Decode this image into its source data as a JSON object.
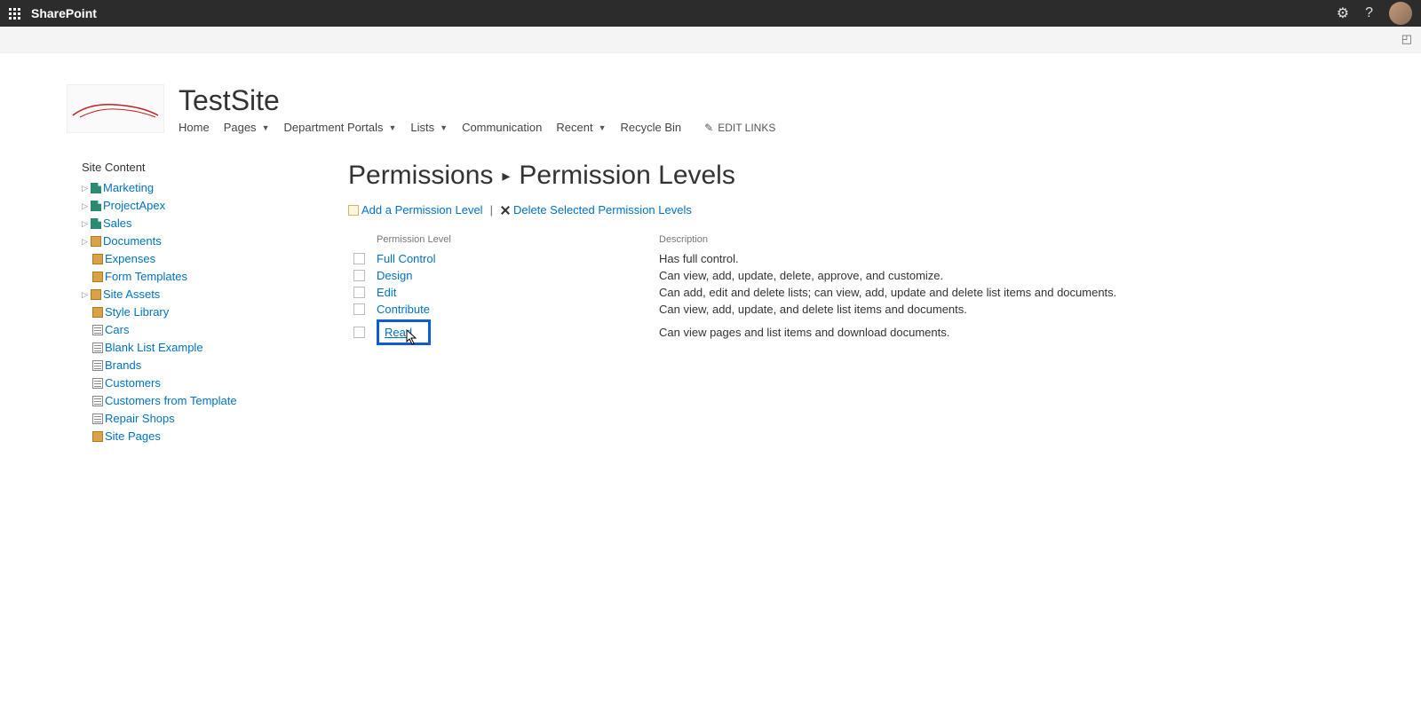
{
  "topbar": {
    "app_name": "SharePoint"
  },
  "site": {
    "title": "TestSite"
  },
  "nav": {
    "home": "Home",
    "pages": "Pages",
    "dept": "Department Portals",
    "lists": "Lists",
    "comm": "Communication",
    "recent": "Recent",
    "recycle": "Recycle Bin",
    "edit_links": "EDIT LINKS"
  },
  "left": {
    "heading": "Site Content",
    "items": {
      "marketing": "Marketing",
      "projectapex": "ProjectApex",
      "sales": "Sales",
      "documents": "Documents",
      "expenses": "Expenses",
      "formtemplates": "Form Templates",
      "siteassets": "Site Assets",
      "stylelibrary": "Style Library",
      "cars": "Cars",
      "blanklist": "Blank List Example",
      "brands": "Brands",
      "customers": "Customers",
      "customerstpl": "Customers from Template",
      "repairshops": "Repair Shops",
      "sitepages": "Site Pages"
    }
  },
  "breadcrumb": {
    "parent": "Permissions",
    "current": "Permission Levels"
  },
  "actions": {
    "add": "Add a Permission Level",
    "delete": "Delete Selected Permission Levels"
  },
  "table": {
    "headers": {
      "name": "Permission Level",
      "desc": "Description"
    },
    "rows": {
      "full": {
        "name": "Full Control",
        "desc": "Has full control."
      },
      "design": {
        "name": "Design",
        "desc": "Can view, add, update, delete, approve, and customize."
      },
      "edit": {
        "name": "Edit",
        "desc": "Can add, edit and delete lists; can view, add, update and delete list items and documents."
      },
      "contribute": {
        "name": "Contribute",
        "desc": "Can view, add, update, and delete list items and documents."
      },
      "read": {
        "name": "Read",
        "desc": "Can view pages and list items and download documents."
      }
    }
  }
}
